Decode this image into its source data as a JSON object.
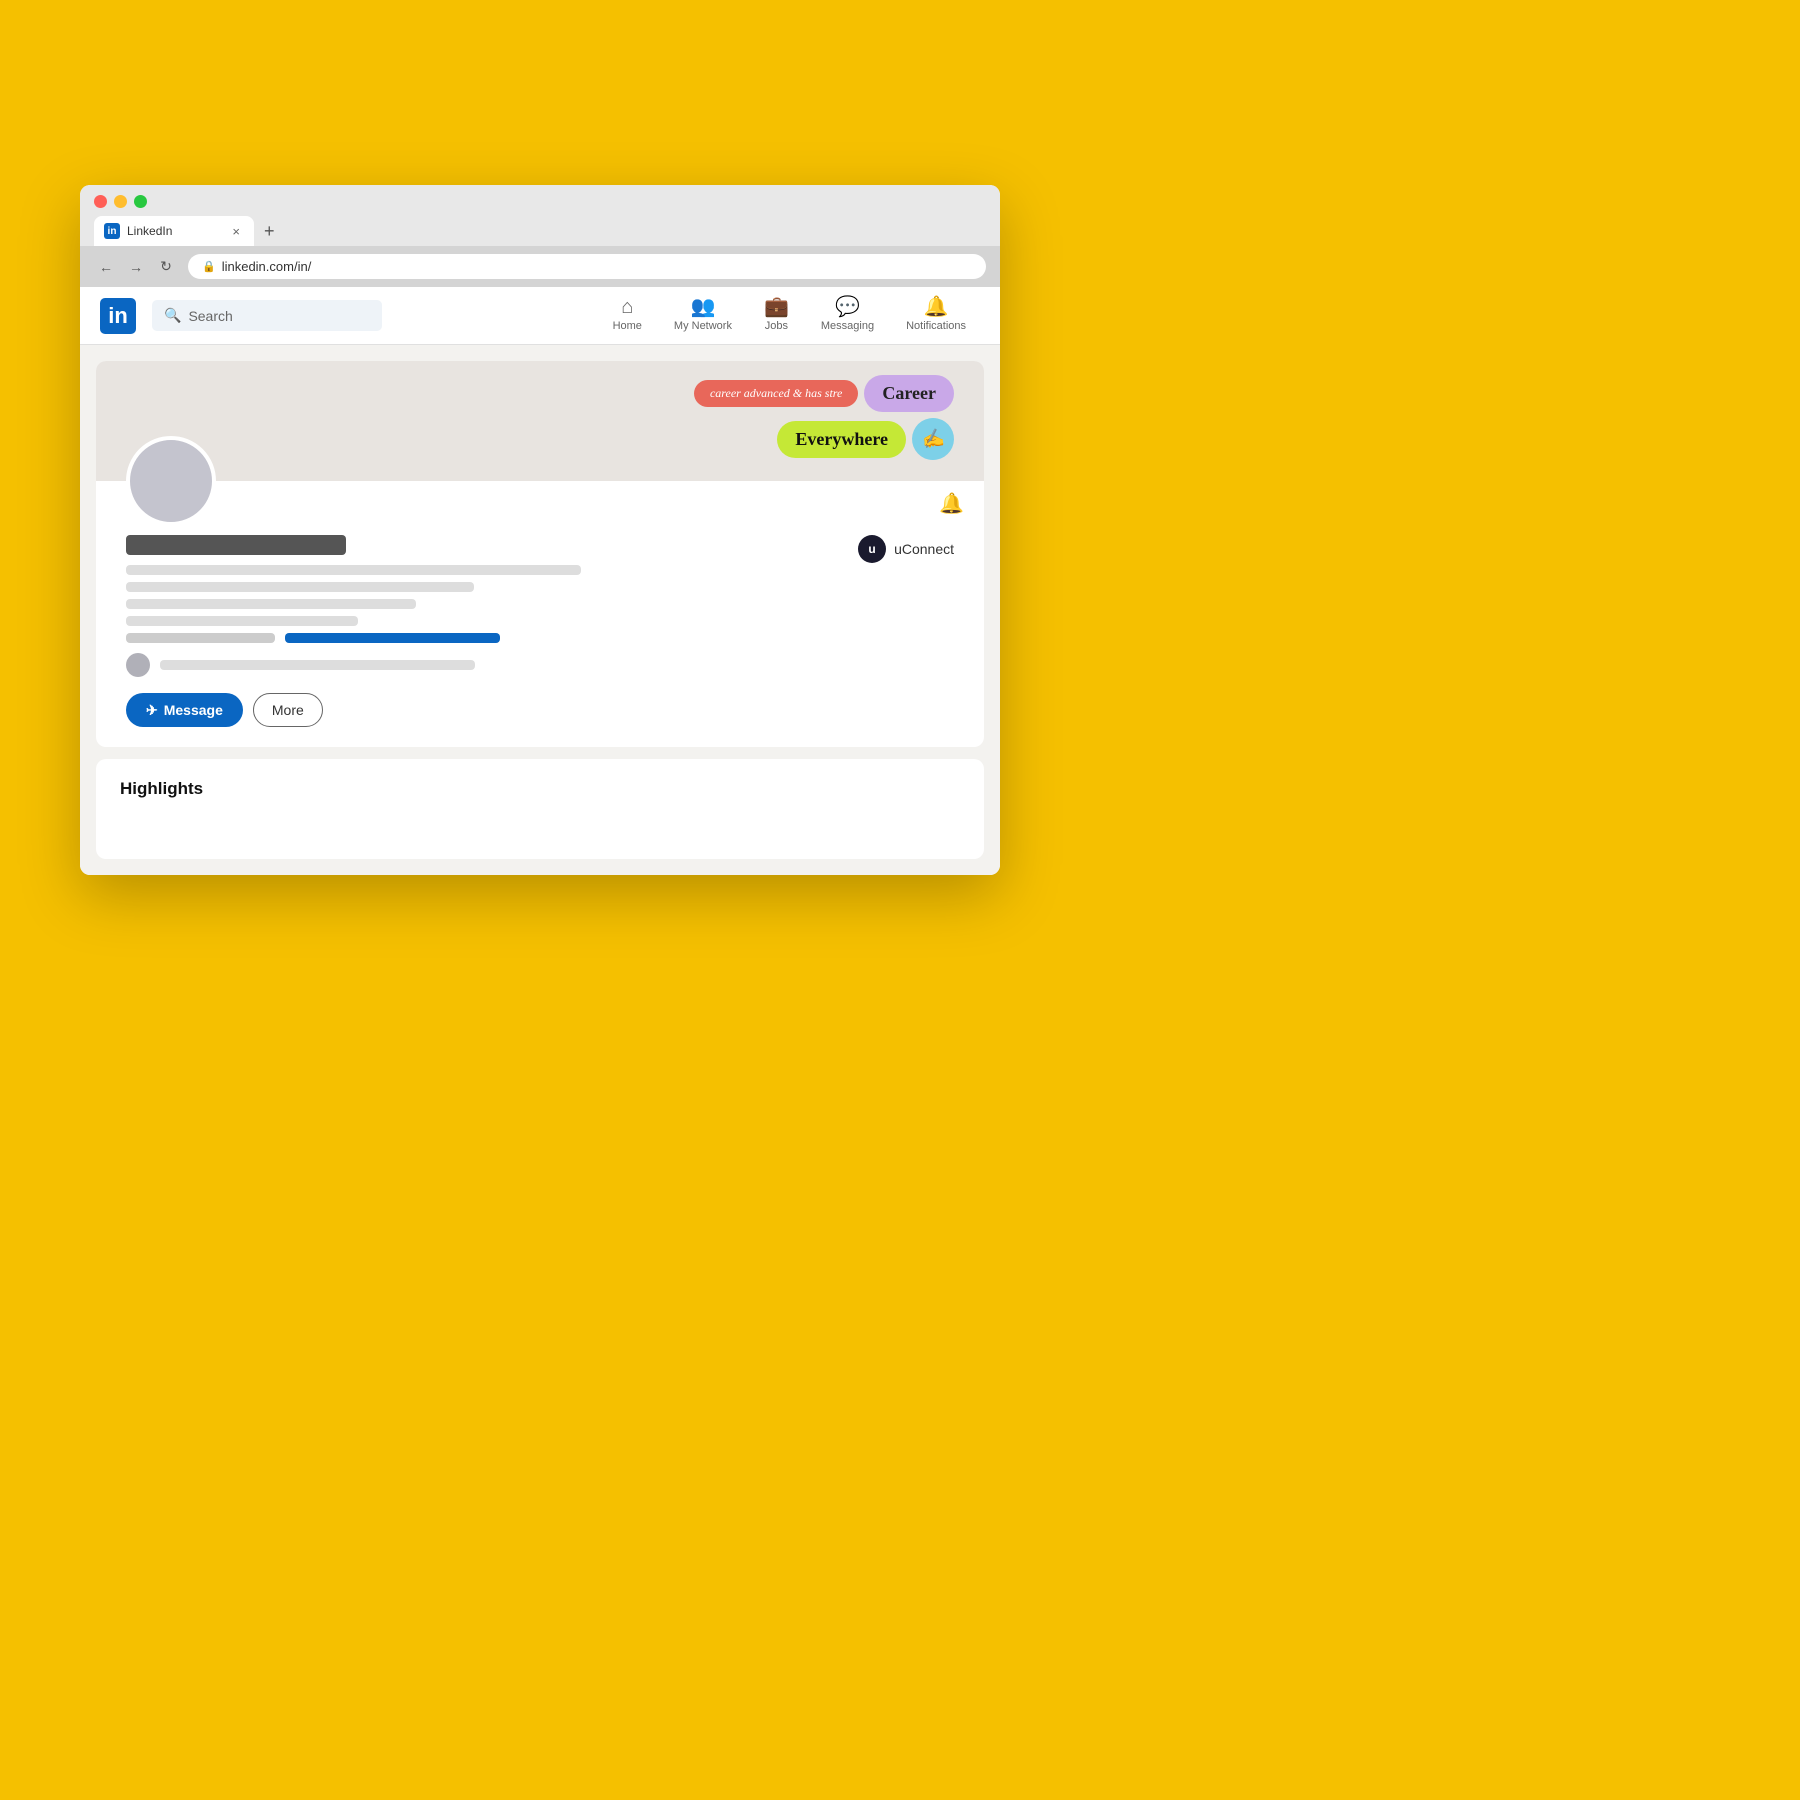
{
  "browser": {
    "tab_label": "LinkedIn",
    "tab_favicon": "in",
    "new_tab_symbol": "+",
    "close_symbol": "×",
    "back_symbol": "←",
    "forward_symbol": "→",
    "refresh_symbol": "↻",
    "url": "linkedin.com/in/"
  },
  "linkedin_nav": {
    "logo_text": "in",
    "search_placeholder": "Search",
    "nav_items": [
      {
        "id": "home",
        "label": "Home",
        "icon": "⌂"
      },
      {
        "id": "my-network",
        "label": "My Network",
        "icon": "👥"
      },
      {
        "id": "jobs",
        "label": "Jobs",
        "icon": "💼"
      },
      {
        "id": "messaging",
        "label": "Messaging",
        "icon": "💬"
      },
      {
        "id": "notifications",
        "label": "Notifications",
        "icon": "🔔"
      }
    ]
  },
  "profile": {
    "uconnect_label": "uConnect",
    "uconnect_logo": "u",
    "bell_icon": "🔔",
    "message_button": "Message",
    "message_icon": "✈",
    "more_button": "More"
  },
  "career_banner": {
    "pink_text": "career advanced & has stre",
    "purple_text": "Career",
    "green_text": "Everywhere",
    "squiggle": "✍"
  },
  "highlights": {
    "title": "Highlights"
  },
  "colors": {
    "linkedin_blue": "#0a66c2",
    "page_bg": "#f3f2ef",
    "yellow_bg": "#F5C000"
  }
}
